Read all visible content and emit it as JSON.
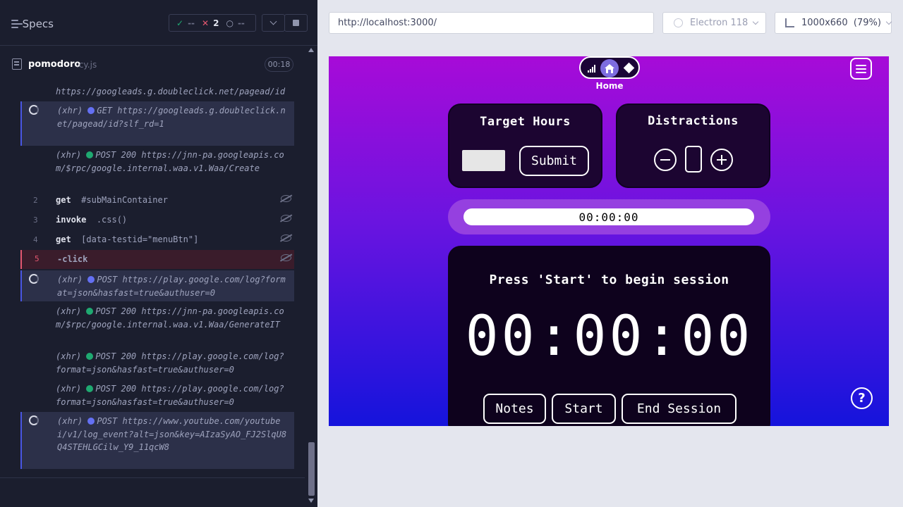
{
  "reporter": {
    "specs_label": "Specs",
    "stats": {
      "passed": "--",
      "failed": "2",
      "pending": "--",
      "pass_icon": "✓",
      "fail_icon": "✕",
      "pend_icon": "○"
    },
    "spec": {
      "name": "pomodoro",
      "ext": ".cy.js",
      "time": "00:18"
    },
    "log": [
      {
        "text": "https://googleads.g.doubleclick.net/pagead/id"
      },
      {
        "prefix": "(xhr)",
        "method": "GET",
        "text": "https://googleads.g.doubleclick.net/pagead/id?slf_rd=1"
      },
      {
        "prefix": "(xhr)",
        "method": "POST 200",
        "text": "https://jnn-pa.googleapis.com/$rpc/google.internal.waa.v1.Waa/Create"
      },
      {
        "num": "2",
        "cmd": "get",
        "arg": "#subMainContainer"
      },
      {
        "num": "3",
        "cmd": "invoke",
        "arg": ".css()"
      },
      {
        "num": "4",
        "cmd": "get",
        "arg": "[data-testid=\"menuBtn\"]"
      },
      {
        "num": "5",
        "cmd": "-click",
        "arg": ""
      },
      {
        "prefix": "(xhr)",
        "method": "POST",
        "text": "https://play.google.com/log?format=json&hasfast=true&authuser=0"
      },
      {
        "prefix": "(xhr)",
        "method": "POST 200",
        "text": "https://jnn-pa.googleapis.com/$rpc/google.internal.waa.v1.Waa/GenerateIT"
      },
      {
        "prefix": "(xhr)",
        "method": "POST 200",
        "text": "https://play.google.com/log?format=json&hasfast=true&authuser=0"
      },
      {
        "prefix": "(xhr)",
        "method": "POST 200",
        "text": "https://play.google.com/log?format=json&hasfast=true&authuser=0"
      },
      {
        "prefix": "(xhr)",
        "method": "POST",
        "text": "https://www.youtube.com/youtubei/v1/log_event?alt=json&key=AIzaSyAO_FJ2SlqU8Q4STEHLGCilw_Y9_11qcW8"
      }
    ]
  },
  "browser": {
    "url": "http://localhost:3000/",
    "browser_name": "Electron 118",
    "viewport": "1000x660",
    "zoom": "(79%)"
  },
  "app": {
    "nav_label": "Home",
    "target_title": "Target Hours",
    "target_input_value": "",
    "submit_label": "Submit",
    "distractions_title": "Distractions",
    "distractions_count": "0",
    "progress_text": "00:00:00",
    "session_message": "Press 'Start' to begin session",
    "timer": "00:00:00",
    "notes_label": "Notes",
    "start_label": "Start",
    "end_label": "End Session",
    "help_label": "?"
  },
  "colors": {
    "accent_blue": "#4956e3",
    "error_red": "#e45770",
    "success_green": "#1fa971",
    "app_gradient_top": "#a70bd8",
    "app_gradient_bottom": "#1514dc"
  }
}
